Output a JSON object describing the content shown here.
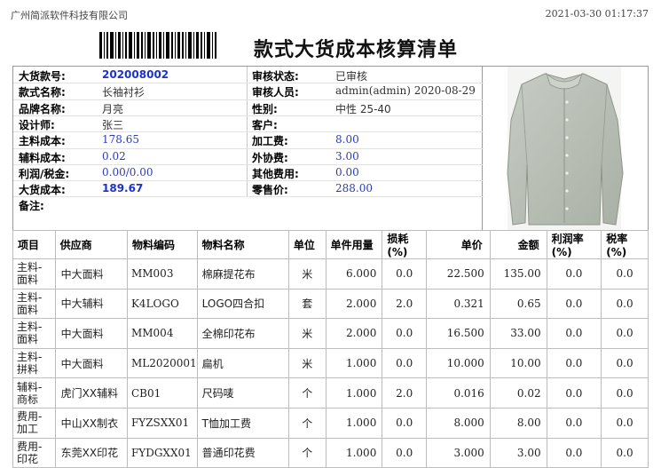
{
  "header": {
    "company": "广州简派软件科技有限公司",
    "datetime": "2021-03-30 01:17:37",
    "title": "款式大货成本核算清单"
  },
  "info": {
    "style_no_label": "大货款号:",
    "style_no": "202008002",
    "style_name_label": "款式名称:",
    "style_name": "长袖衬衫",
    "brand_label": "品牌名称:",
    "brand": "月亮",
    "designer_label": "设计师:",
    "designer": "张三",
    "main_cost_label": "主料成本:",
    "main_cost": "178.65",
    "aux_cost_label": "辅料成本:",
    "aux_cost": "0.02",
    "profit_tax_label": "利润/税金:",
    "profit_tax": "0.00/0.00",
    "bulk_cost_label": "大货成本:",
    "bulk_cost": "189.67",
    "remarks_label": "备注:",
    "audit_status_label": "审核状态:",
    "audit_status": "已审核",
    "auditor_label": "审核人员:",
    "auditor": "admin(admin) 2020-08-29",
    "gender_label": "性别:",
    "gender": "中性 25-40",
    "customer_label": "客户:",
    "processing_fee_label": "加工费:",
    "processing_fee": "8.00",
    "outsourcing_fee_label": "外协费:",
    "outsourcing_fee": "3.00",
    "other_fee_label": "其他费用:",
    "other_fee": "0.00",
    "retail_price_label": "零售价:",
    "retail_price": "288.00"
  },
  "table": {
    "headers": [
      "项目",
      "供应商",
      "物料编码",
      "物料名称",
      "单位",
      "单件用量",
      "损耗(%)",
      "单价",
      "金额",
      "利润率(%)",
      "税率(%)"
    ],
    "rows": [
      {
        "item1": "主料-",
        "item2": "面料",
        "supplier": "中大面料",
        "code": "MM003",
        "name": "棉麻提花布",
        "unit": "米",
        "qty": "6.000",
        "loss": "0.0",
        "price": "22.500",
        "amount": "135.00",
        "profit": "0.0",
        "tax": "0.0"
      },
      {
        "item1": "主料-",
        "item2": "面料",
        "supplier": "中大辅料",
        "code": "K4LOGO",
        "name": "LOGO四合扣",
        "unit": "套",
        "qty": "2.000",
        "loss": "2.0",
        "price": "0.321",
        "amount": "0.65",
        "profit": "0.0",
        "tax": "0.0"
      },
      {
        "item1": "主料-",
        "item2": "面料",
        "supplier": "中大面料",
        "code": "MM004",
        "name": "全棉印花布",
        "unit": "米",
        "qty": "2.000",
        "loss": "0.0",
        "price": "16.500",
        "amount": "33.00",
        "profit": "0.0",
        "tax": "0.0"
      },
      {
        "item1": "主料-",
        "item2": "拼料",
        "supplier": "中大面料",
        "code": "ML2020001",
        "name": "扁机",
        "unit": "米",
        "qty": "1.000",
        "loss": "0.0",
        "price": "10.000",
        "amount": "10.00",
        "profit": "0.0",
        "tax": "0.0"
      },
      {
        "item1": "辅料-",
        "item2": "商标",
        "supplier": "虎门XX辅料",
        "code": "CB01",
        "name": "尺码唛",
        "unit": "个",
        "qty": "1.000",
        "loss": "2.0",
        "price": "0.016",
        "amount": "0.02",
        "profit": "0.0",
        "tax": "0.0"
      },
      {
        "item1": "费用-",
        "item2": "加工",
        "supplier": "中山XX制衣",
        "code": "FYZSXX01",
        "name": "T恤加工费",
        "unit": "个",
        "qty": "1.000",
        "loss": "0.0",
        "price": "8.000",
        "amount": "8.00",
        "profit": "0.0",
        "tax": "0.0"
      },
      {
        "item1": "费用-",
        "item2": "印花",
        "supplier": "东莞XX印花",
        "code": "FYDGXX01",
        "name": "普通印花费",
        "unit": "个",
        "qty": "1.000",
        "loss": "0.0",
        "price": "3.000",
        "amount": "3.00",
        "profit": "0.0",
        "tax": "0.0"
      }
    ]
  },
  "colors": {
    "value_blue": "#2a3bbf",
    "border": "#bdbdbd",
    "shirt": "#b9c0b7"
  },
  "icons": {
    "barcode": "barcode-image",
    "product_photo": "shirt-photo"
  }
}
